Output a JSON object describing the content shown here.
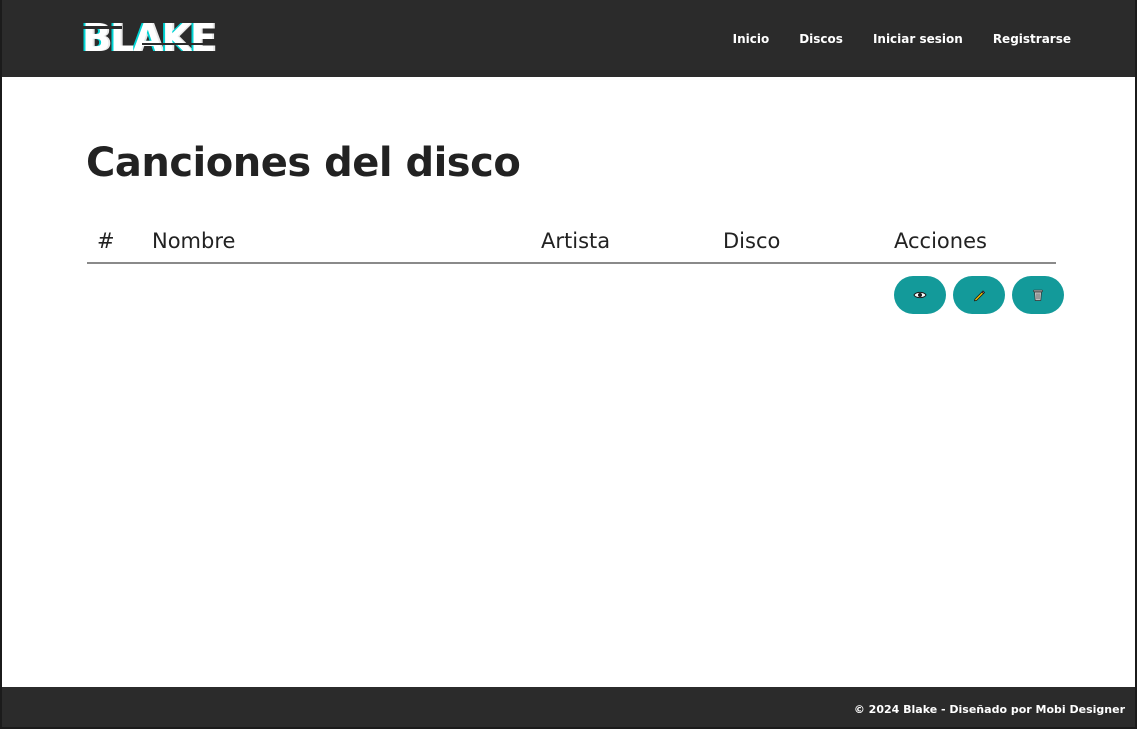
{
  "header": {
    "logo_text": "BLAKE",
    "nav": [
      "Inicio",
      "Discos",
      "Iniciar sesion",
      "Registrarse"
    ]
  },
  "main": {
    "title": "Canciones del disco",
    "table": {
      "columns": [
        "#",
        "Nombre",
        "Artista",
        "Disco",
        "Acciones"
      ],
      "rows": []
    },
    "actions": [
      {
        "icon": "eye-icon"
      },
      {
        "icon": "pencil-icon"
      },
      {
        "icon": "trash-icon"
      }
    ]
  },
  "footer": {
    "text": "© 2024 Blake - Diseñado por Mobi Designer"
  },
  "colors": {
    "navbar": "#2b2b2b",
    "accent": "#139a9a",
    "text": "#222222"
  }
}
